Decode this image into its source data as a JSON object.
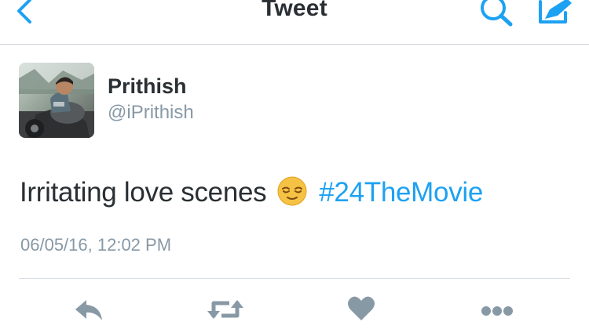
{
  "navbar": {
    "title": "Tweet",
    "back_icon": "chevron-left-icon",
    "search_icon": "search-icon",
    "compose_icon": "compose-icon",
    "accent_color": "#1da1f2"
  },
  "tweet": {
    "author": {
      "display_name": "Prithish",
      "handle": "@iPrithish"
    },
    "text": "Irritating love scenes",
    "emoji": "relieved-face-emoji",
    "hashtag": "#24TheMovie",
    "timestamp": "06/05/16, 12:02 PM",
    "actions": [
      {
        "name": "reply",
        "icon": "reply-icon"
      },
      {
        "name": "retweet",
        "icon": "retweet-icon"
      },
      {
        "name": "like",
        "icon": "heart-icon"
      },
      {
        "name": "more",
        "icon": "more-icon"
      }
    ],
    "hashtag_color": "#1da1f2",
    "action_icon_color": "#8899a6"
  }
}
